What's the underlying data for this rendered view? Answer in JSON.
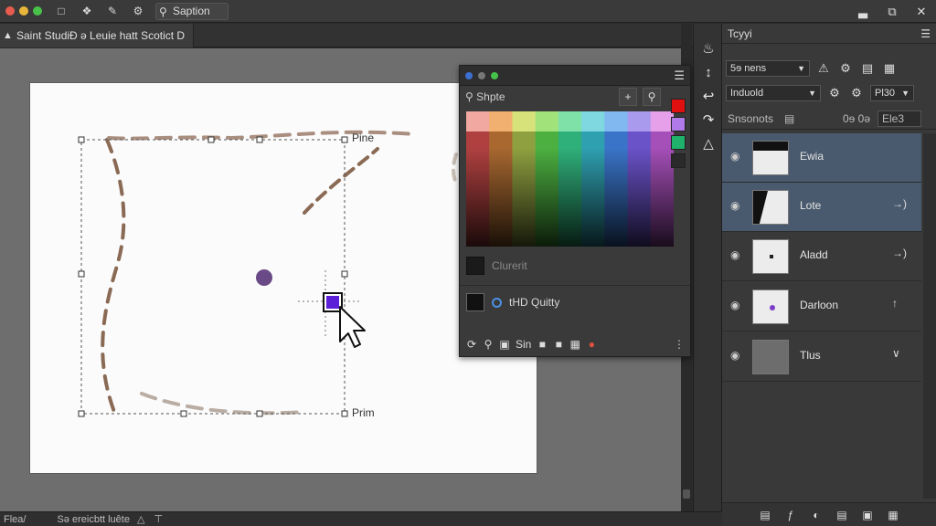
{
  "titlebar": {
    "search_label": "Saption",
    "search_icon": "search-icon",
    "tool_icons": [
      "document-icon",
      "puzzle-icon",
      "pen-square-icon",
      "settings-icon"
    ],
    "window_controls": [
      "minimize-icon",
      "restore-icon",
      "close-icon"
    ],
    "window_controls_glyphs": [
      "▃",
      "⧉",
      "✕"
    ]
  },
  "document_tab": {
    "title": "Saint StudiƉ ə Leuie hatt Scotict D"
  },
  "canvas": {
    "label_top_right": "Pine",
    "label_bottom_right": "Prim",
    "artboard_color": "#fbfbfb",
    "selected_color": "#5a1fd6",
    "dot_color": "#6a4a86"
  },
  "status_bar": {
    "left": "Flea/",
    "center": "Sə ereicbtt luête"
  },
  "tool_strip": {
    "tools": [
      "brush-icon",
      "transform-icon",
      "return-icon",
      "curve-icon",
      "shape-icon"
    ]
  },
  "color_panel": {
    "search_label": "Shpte",
    "current_label": "Clurerit",
    "quality_label": "tHD Quitty",
    "footer_label": "Sin",
    "swatches": [
      "#e01010",
      "#b07ae8",
      "#1fb26a",
      "#2a2a2a"
    ],
    "grid_top_colors": [
      "#f0a8a0",
      "#f2b070",
      "#d8e27a",
      "#a2e27a",
      "#7fe0a8",
      "#7fd8e0",
      "#80b8ef",
      "#a99aee",
      "#e6a0ea"
    ],
    "grid_mid_colors": [
      "#b04040",
      "#a86830",
      "#8fa040",
      "#4cb040",
      "#2fb07a",
      "#2fa0b0",
      "#3a74c8",
      "#6a52c8",
      "#a54fb8"
    ]
  },
  "right_panel": {
    "title": "Tcyyi",
    "dropdown1": "5ɘ nens",
    "dropdown2": "Induold",
    "field_value": "Pl30",
    "layers_header": "Snsonots",
    "header_field1": "0ɘ 0ǝ",
    "header_field2": "Ele3",
    "layers": [
      {
        "name": "Ewia",
        "action": "",
        "selected": true
      },
      {
        "name": "Lote",
        "action": "→)",
        "selected": true
      },
      {
        "name": "Aladd",
        "action": "→)",
        "selected": false
      },
      {
        "name": "Darloon",
        "action": "↑",
        "selected": false
      },
      {
        "name": "Tlus",
        "action": "∨",
        "selected": false
      }
    ]
  }
}
